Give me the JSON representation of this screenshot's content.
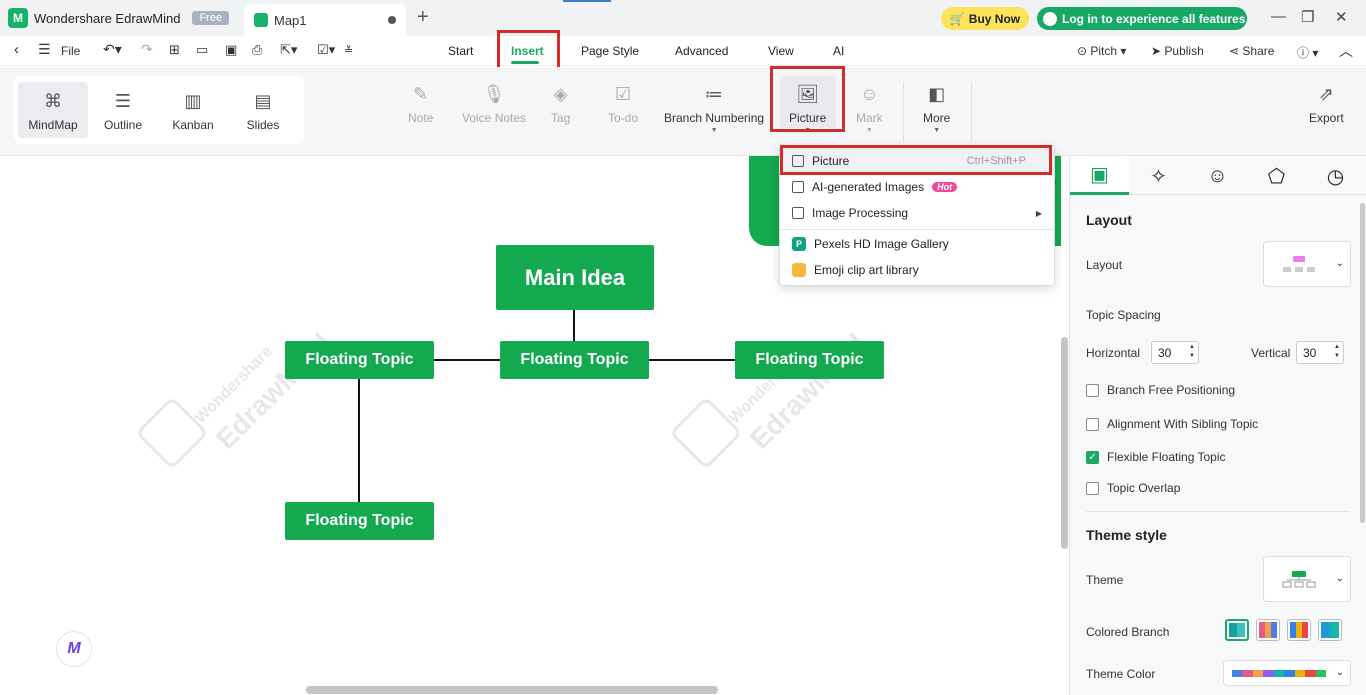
{
  "titlebar": {
    "app_name": "Wondershare EdrawMind",
    "app_badge": "Free",
    "doc_tab": "Map1",
    "new_tab_icon": "plus-icon",
    "buy_now": "Buy Now",
    "login": "Log in to experience all features"
  },
  "menu": {
    "file": "File",
    "tabs": [
      "Start",
      "Insert",
      "Page Style",
      "Advanced",
      "View",
      "AI"
    ],
    "active_tab": "Insert",
    "pitch": "Pitch",
    "publish": "Publish",
    "share": "Share"
  },
  "ribbon": {
    "views": [
      "MindMap",
      "Outline",
      "Kanban",
      "Slides"
    ],
    "selected_view": "MindMap",
    "tools": {
      "note": "Note",
      "voice_notes": "Voice Notes",
      "tag": "Tag",
      "todo": "To-do",
      "branch_numbering": "Branch Numbering",
      "picture": "Picture",
      "mark": "Mark",
      "more": "More",
      "export": "Export"
    }
  },
  "dropdown": {
    "picture": "Picture",
    "picture_shortcut": "Ctrl+Shift+P",
    "ai_images": "AI-generated Images",
    "hot_badge": "Hot",
    "image_processing": "Image Processing",
    "pexels": "Pexels HD Image Gallery",
    "emoji": "Emoji clip art library"
  },
  "canvas": {
    "main_idea": "Main Idea",
    "topics": [
      "Floating Topic",
      "Floating Topic",
      "Floating Topic",
      "Floating Topic"
    ],
    "watermark_line1": "Wondershare",
    "watermark_line2": "EdrawMind"
  },
  "panel": {
    "layout_heading": "Layout",
    "layout_label": "Layout",
    "topic_spacing": "Topic Spacing",
    "horizontal_label": "Horizontal",
    "horizontal_value": "30",
    "vertical_label": "Vertical",
    "vertical_value": "30",
    "branch_free": "Branch Free Positioning",
    "branch_free_checked": false,
    "alignment_sibling": "Alignment With Sibling Topic",
    "alignment_sibling_checked": false,
    "flexible_floating": "Flexible Floating Topic",
    "flexible_floating_checked": true,
    "topic_overlap": "Topic Overlap",
    "topic_overlap_checked": false,
    "theme_style_heading": "Theme style",
    "theme_label": "Theme",
    "colored_branch": "Colored Branch",
    "theme_color": "Theme Color"
  },
  "colors": {
    "accent": "#1aa864",
    "topic_fill": "#12a94f",
    "highlight_box": "#d62b2b",
    "theme_colors": [
      "#4b7bec",
      "#e05b8b",
      "#f0a04b",
      "#8b5cf6",
      "#14b8a6",
      "#2f80ed",
      "#eab308",
      "#ef4444",
      "#22c55e"
    ]
  }
}
